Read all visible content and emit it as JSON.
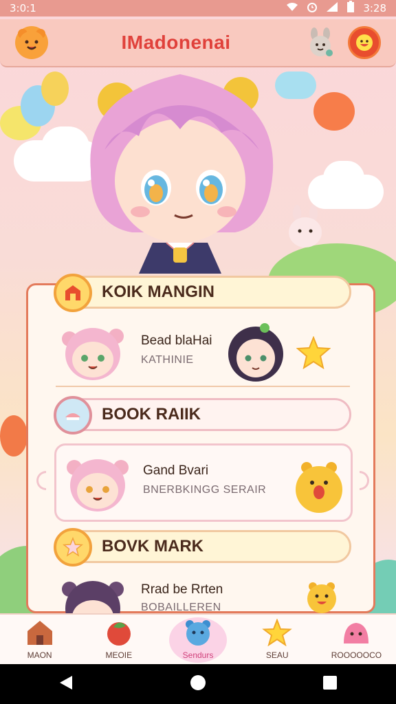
{
  "status_bar": {
    "time_left": "3:0:1",
    "time_right": "3:28"
  },
  "header": {
    "title": "IMadonenai"
  },
  "sections": [
    {
      "title": "KOIK MANGIN"
    },
    {
      "title": "BOOK RAIIK"
    },
    {
      "title": "BOVK MARK"
    }
  ],
  "cards": [
    {
      "title": "Bead blaHai",
      "subtitle": "KATHINIE"
    },
    {
      "title": "Gand Bvari",
      "subtitle": "BNERBKINGG SERAIR"
    },
    {
      "title": "Rrad be Rrten",
      "subtitle": "BOBAILLEREN"
    }
  ],
  "bottom_nav": [
    {
      "label": "MAON",
      "icon": "house-icon"
    },
    {
      "label": "MEOIE",
      "icon": "apple-icon"
    },
    {
      "label": "Sendurs",
      "icon": "bear-icon",
      "active": true
    },
    {
      "label": "SEAU",
      "icon": "star-icon"
    },
    {
      "label": "ROOOOOCO",
      "icon": "slime-icon"
    }
  ],
  "colors": {
    "accent": "#e0413b",
    "header_bg": "#f9c9bf",
    "panel_border": "#e37a5b"
  }
}
